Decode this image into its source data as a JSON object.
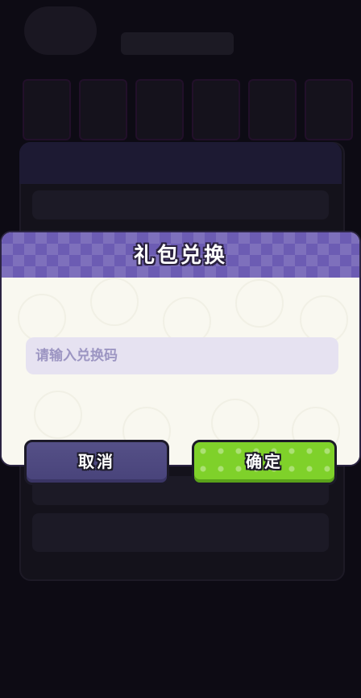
{
  "dialog": {
    "title": "礼包兑换",
    "input_placeholder": "请输入兑换码",
    "cancel_label": "取消",
    "confirm_label": "确定"
  },
  "colors": {
    "header": "#6c5cb3",
    "cancel_button": "#4e4982",
    "confirm_button": "#7fd12a",
    "input_bg": "#e6e2f1",
    "overlay": "#0d0b14"
  }
}
